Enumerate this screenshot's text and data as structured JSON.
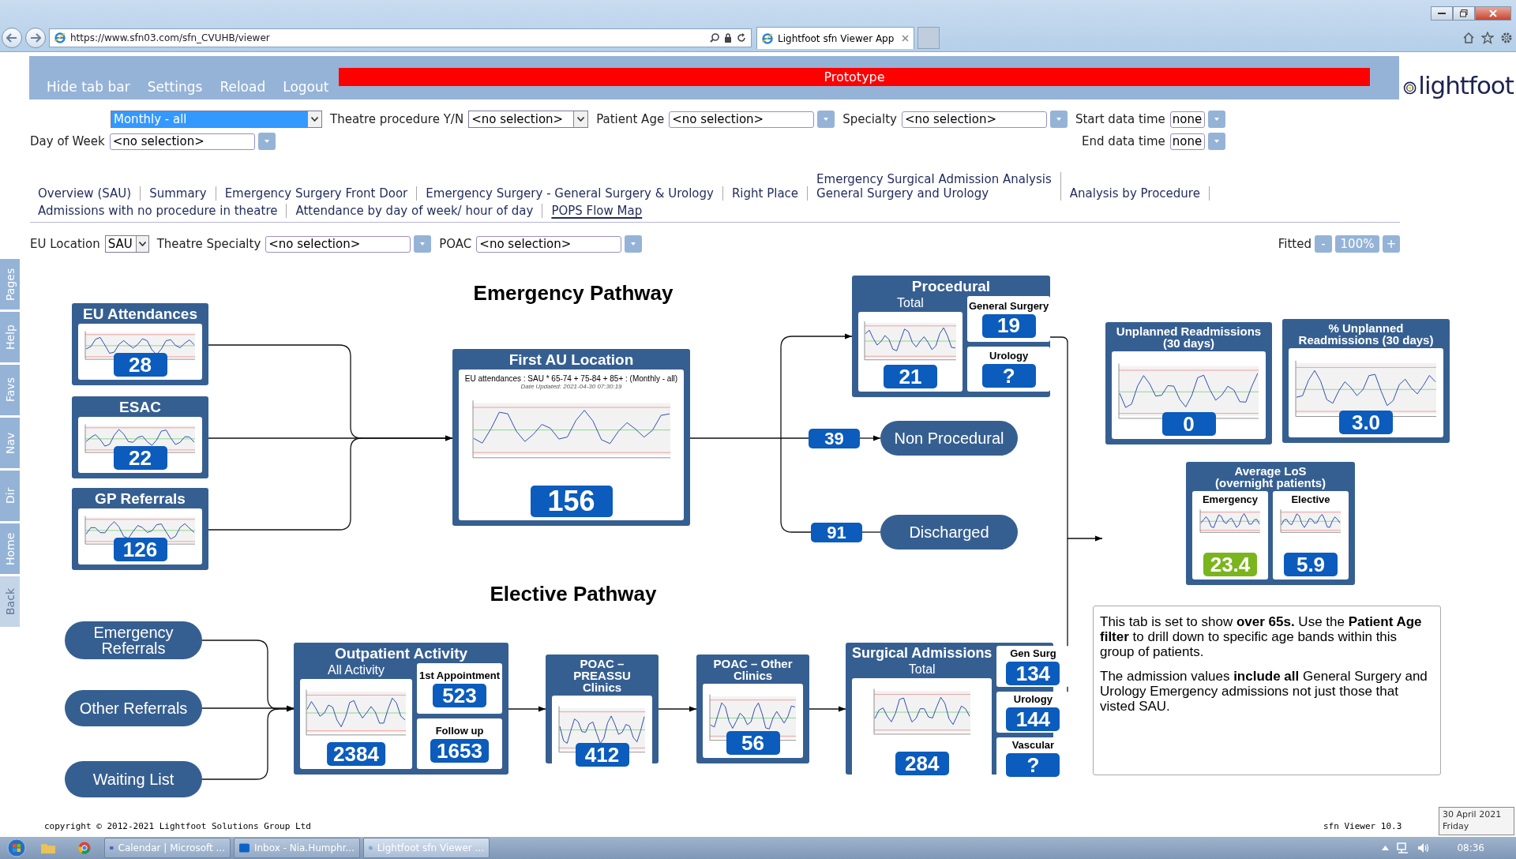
{
  "browser": {
    "url": "https://www.sfn03.com/sfn_CVUHB/viewer",
    "tab_title": "Lightfoot sfn Viewer App"
  },
  "app_menu": [
    "Hide tab bar",
    "Settings",
    "Reload",
    "Logout"
  ],
  "banner": "Prototype",
  "logo": "lightfoot",
  "filter_rows": [
    [
      {
        "kind": "select",
        "value": "Monthly - all",
        "highlighted": true
      },
      {
        "kind": "select",
        "label": "Theatre procedure Y/N",
        "value": "<no selection>",
        "highlighted": false
      },
      {
        "kind": "combo",
        "label": "Patient Age",
        "value": "<no selection>",
        "highlighted": false
      },
      {
        "kind": "combo",
        "label": "Specialty",
        "value": "<no selection>",
        "highlighted": false
      },
      {
        "kind": "combo",
        "label": "Start data time",
        "value": "none",
        "highlighted": false
      }
    ],
    [
      {
        "kind": "combo",
        "label": "Day of Week",
        "value": "<no selection>",
        "highlighted": false
      },
      {
        "kind": "combo",
        "label": "End data time",
        "value": "none",
        "highlighted": false
      }
    ]
  ],
  "tab_rows": [
    [
      {
        "label": "Overview (SAU)",
        "selected": false
      },
      {
        "label": "Summary",
        "selected": false
      },
      {
        "label": "Emergency Surgery Front Door",
        "selected": false
      },
      {
        "label": "Emergency Surgery - General Surgery & Urology",
        "selected": false
      },
      {
        "label": "Right Place",
        "selected": false
      },
      {
        "label": "Emergency Surgical Admission Analysis\nGeneral Surgery and Urology",
        "selected": false
      },
      {
        "label": "Analysis by Procedure",
        "selected": false
      }
    ],
    [
      {
        "label": "Admissions with no procedure in theatre",
        "selected": false
      },
      {
        "label": "Attendance by day of week/ hour of day",
        "selected": false
      },
      {
        "label": "POPS Flow Map",
        "selected": true
      }
    ]
  ],
  "view_filters": [
    {
      "kind": "select",
      "label": "EU Location",
      "value": "SAU"
    },
    {
      "kind": "combo",
      "label": "Theatre Specialty",
      "value": "<no selection>"
    },
    {
      "kind": "combo",
      "label": "POAC",
      "value": "<no selection>"
    }
  ],
  "zoom": {
    "label": "Fitted",
    "minus": "-",
    "level": "100%",
    "plus": "+"
  },
  "side_tabs": [
    {
      "label": "Pages",
      "disabled": false
    },
    {
      "label": "Help",
      "disabled": false
    },
    {
      "label": "Favs",
      "disabled": false
    },
    {
      "label": "Nav",
      "disabled": false
    },
    {
      "label": "Dir",
      "disabled": false
    },
    {
      "label": "Home",
      "disabled": false
    },
    {
      "label": "Back",
      "disabled": true
    }
  ],
  "emergency_pathway": {
    "title": "Emergency Pathway",
    "sources": [
      {
        "title": "EU Attendances",
        "value": "28"
      },
      {
        "title": "ESAC",
        "value": "22"
      },
      {
        "title": "GP Referrals",
        "value": "126"
      }
    ],
    "first_au": {
      "title": "First AU Location",
      "chart_title": "EU attendances : SAU * 65-74 + 75-84 + 85+ : (Monthly - all)",
      "chart_subtitle": "Date Updated: 2021-04-30 07:30:19",
      "value": "156"
    },
    "procedural": {
      "title": "Procedural",
      "total_label": "Total",
      "total_value": "21",
      "panels": [
        {
          "label": "General Surgery",
          "value": "19"
        },
        {
          "label": "Urology",
          "value": "?"
        }
      ]
    },
    "branches": [
      {
        "value": "39",
        "label": "Non Procedural"
      },
      {
        "value": "91",
        "label": "Discharged"
      }
    ]
  },
  "readmissions": [
    {
      "title": "Unplanned Readmissions\n(30 days)",
      "value": "0"
    },
    {
      "title": "% Unplanned\nReadmissions (30 days)",
      "value": "3.0"
    }
  ],
  "average_los": {
    "title": "Average LoS\n(overnight patients)",
    "panels": [
      {
        "label": "Emergency",
        "value": "23.4",
        "color": "#7ab51d"
      },
      {
        "label": "Elective",
        "value": "5.9",
        "color": "#0b5cbc"
      }
    ]
  },
  "elective_pathway": {
    "title": "Elective Pathway",
    "sources": [
      "Emergency\nReferrals",
      "Other Referrals",
      "Waiting List"
    ],
    "outpatient": {
      "title": "Outpatient Activity",
      "total_label": "All Activity",
      "total_value": "2384",
      "panels": [
        {
          "label": "1st Appointment",
          "value": "523"
        },
        {
          "label": "Follow up",
          "value": "1653"
        }
      ]
    },
    "clinics": [
      {
        "title": "POAC – PREASSU\nClinics",
        "value": "412"
      },
      {
        "title": "POAC – Other\nClinics",
        "value": "56"
      }
    ],
    "surgical": {
      "title": "Surgical Admissions",
      "total_label": "Total",
      "total_value": "284",
      "panels": [
        {
          "label": "Gen Surg",
          "value": "134"
        },
        {
          "label": "Urology",
          "value": "144"
        },
        {
          "label": "Vascular",
          "value": "?"
        }
      ]
    }
  },
  "note": [
    "This tab is set to show **over 65s.** Use the **Patient Age filter** to drill down to specific age bands within this group of patients.",
    "The admission values **include all** General Surgery and Urology Emergency admissions not just those that visted SAU."
  ],
  "footer": {
    "copyright": "copyright © 2012-2021 Lightfoot Solutions Group Ltd",
    "version": "sfn Viewer 10.3"
  },
  "taskbar": {
    "items": [
      {
        "label": "Calendar | Microsoft ...",
        "selected": false
      },
      {
        "label": "Inbox - Nia.Humphr...",
        "selected": false
      },
      {
        "label": "Lightfoot sfn Viewer ...",
        "selected": true
      }
    ],
    "clock": "08:36",
    "tooltip_date": "30 April 2021",
    "tooltip_day": "Friday"
  }
}
